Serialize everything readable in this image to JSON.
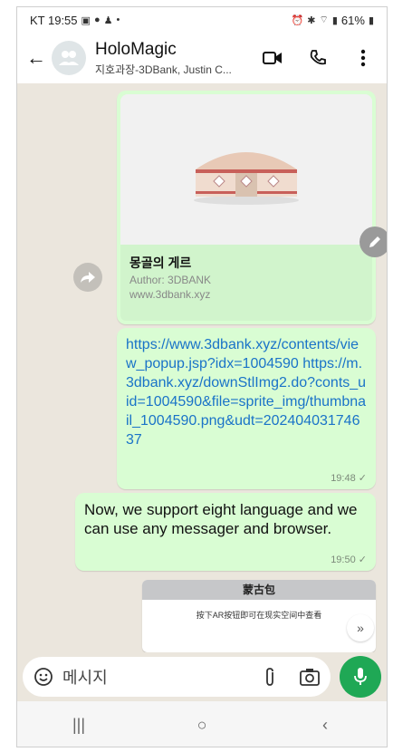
{
  "status_bar": {
    "left": "KT 19:55",
    "battery": "61%"
  },
  "header": {
    "title": "HoloMagic",
    "subtitle": "지호과장-3DBank, Justin C..."
  },
  "messages": {
    "link_preview": {
      "title": "몽골의 게르",
      "author": "Author: 3DBANK",
      "domain": "www.3dbank.xyz"
    },
    "link_text": {
      "text": "https://www.3dbank.xyz/contents/view_popup.jsp?idx=1004590 https://m.3dbank.xyz/downStlImg2.do?conts_uid=1004590&file=sprite_img/thumbnail_1004590.png&udt=20240403174637",
      "time": "19:48 ✓"
    },
    "text_message": {
      "text": "Now, we support eight language and we can use any messager and browser.",
      "time": "19:50 ✓"
    },
    "preview_card": {
      "heading": "蒙古包",
      "body": "按下AR按钮即可在现实空间中查看"
    }
  },
  "input": {
    "placeholder": "메시지"
  },
  "nav": {
    "recents": "|||",
    "home": "○",
    "back": "‹"
  },
  "colors": {
    "bubble": "#d9fdd3",
    "accent": "#1fa855",
    "link": "#1a73c8",
    "chat_bg": "#ebe6dd"
  }
}
